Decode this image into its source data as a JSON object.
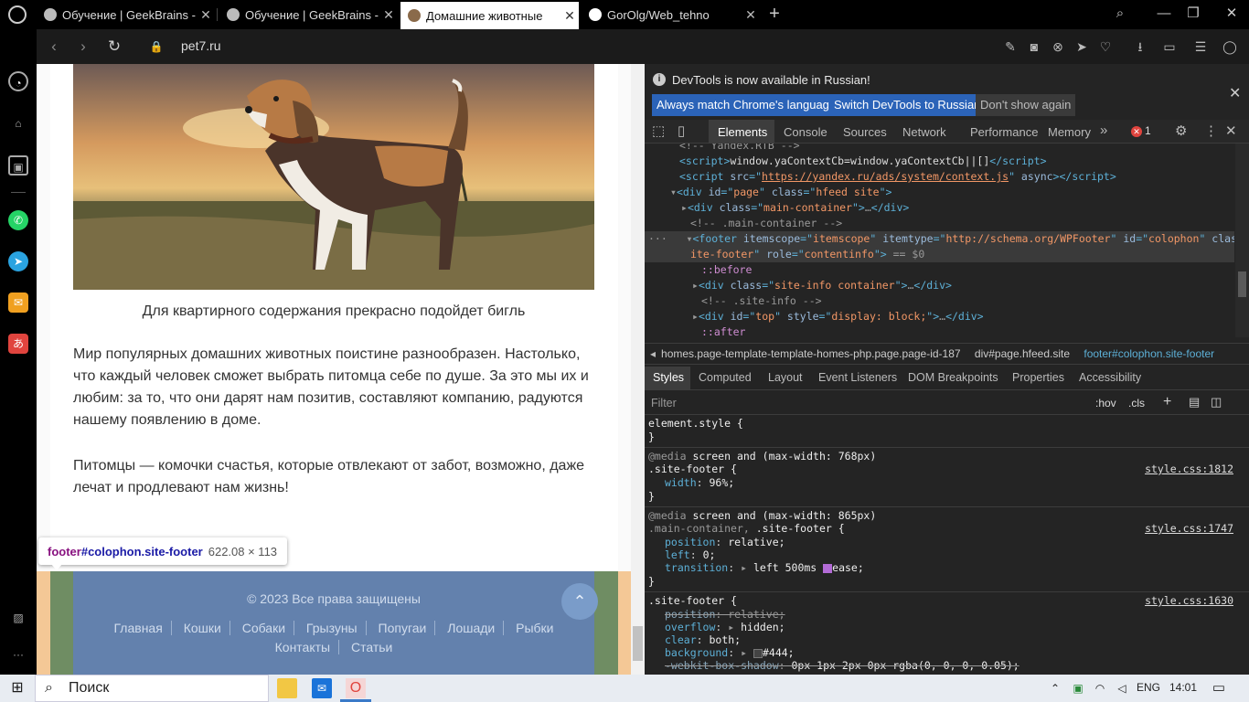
{
  "tabs": [
    {
      "label": "Обучение | GeekBrains - о",
      "active": false
    },
    {
      "label": "Обучение | GeekBrains - о",
      "active": false
    },
    {
      "label": "Домашние животные",
      "active": true
    },
    {
      "label": "GorOlg/Web_tehno",
      "active": false
    }
  ],
  "address": {
    "url": "pet7.ru"
  },
  "page": {
    "caption": "Для квартирного содержания прекрасно подойдет бигль",
    "para1": "Мир популярных домашних животных поистине разнообразен. Настолько, что каждый человек сможет выбрать питомца себе по душе. За это мы их и любим: за то, что они дарят нам позитив, составляют компанию, радуются нашему появлению в доме.",
    "para2": "Питомцы — комочки счастья, которые отвлекают от забот, возможно, даже лечат и продлевают нам жизнь!",
    "tooltip": {
      "tag": "footer",
      "selector": "#colophon.site-footer",
      "size": "622.08 × 113"
    },
    "footer": {
      "copyright": "© 2023 Все права защищены",
      "menu": [
        "Главная",
        "Кошки",
        "Собаки",
        "Грызуны",
        "Попугаи",
        "Лошади",
        "Рыбки",
        "Контакты",
        "Статьи"
      ]
    }
  },
  "devtools": {
    "banner": "DevTools is now available in Russian!",
    "btn_match": "Always match Chrome's language",
    "btn_switch": "Switch DevTools to Russian",
    "btn_dismiss": "Don't show again",
    "tabs": [
      "Elements",
      "Console",
      "Sources",
      "Network",
      "Performance",
      "Memory"
    ],
    "error_count": "1",
    "breadcrumbs": [
      "homes.page-template-template-homes-php.page.page-id-187",
      "div#page.hfeed.site",
      "footer#colophon.site-footer"
    ],
    "style_tabs": [
      "Styles",
      "Computed",
      "Layout",
      "Event Listeners",
      "DOM Breakpoints",
      "Properties",
      "Accessibility"
    ],
    "filter_placeholder": "Filter",
    "hov": ":hov",
    "cls": ".cls"
  },
  "taskbar": {
    "search": "Поиск",
    "lang": "ENG",
    "time": "14:01"
  },
  "colors": {
    "footer_bg": "#6381ad",
    "footer_side": "#6f8d63",
    "devtools_bg": "#242424",
    "accent": "#2b63b8"
  }
}
